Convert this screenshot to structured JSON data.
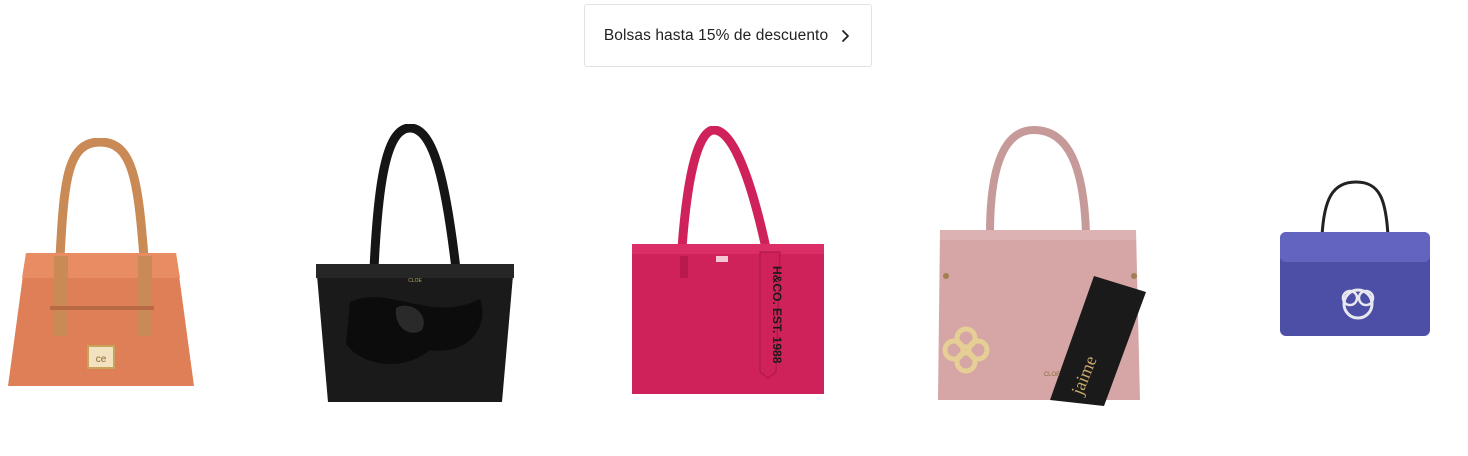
{
  "promo": {
    "label": "Bolsas hasta 15% de descuento"
  },
  "products": [
    {
      "color": "#df7f57",
      "brand_logo": "ce-logo-plate-icon"
    },
    {
      "color": "#111111",
      "brand_mark": "CLOE"
    },
    {
      "color": "#d0225a",
      "brand_tag": "H&CO. EST. 1988",
      "brand_mark": "H&CO"
    },
    {
      "color": "#d6a6a6",
      "strap_text": "jaime"
    },
    {
      "color": "#4d4fa6",
      "brand_logo": "ce-logo-icon"
    }
  ]
}
